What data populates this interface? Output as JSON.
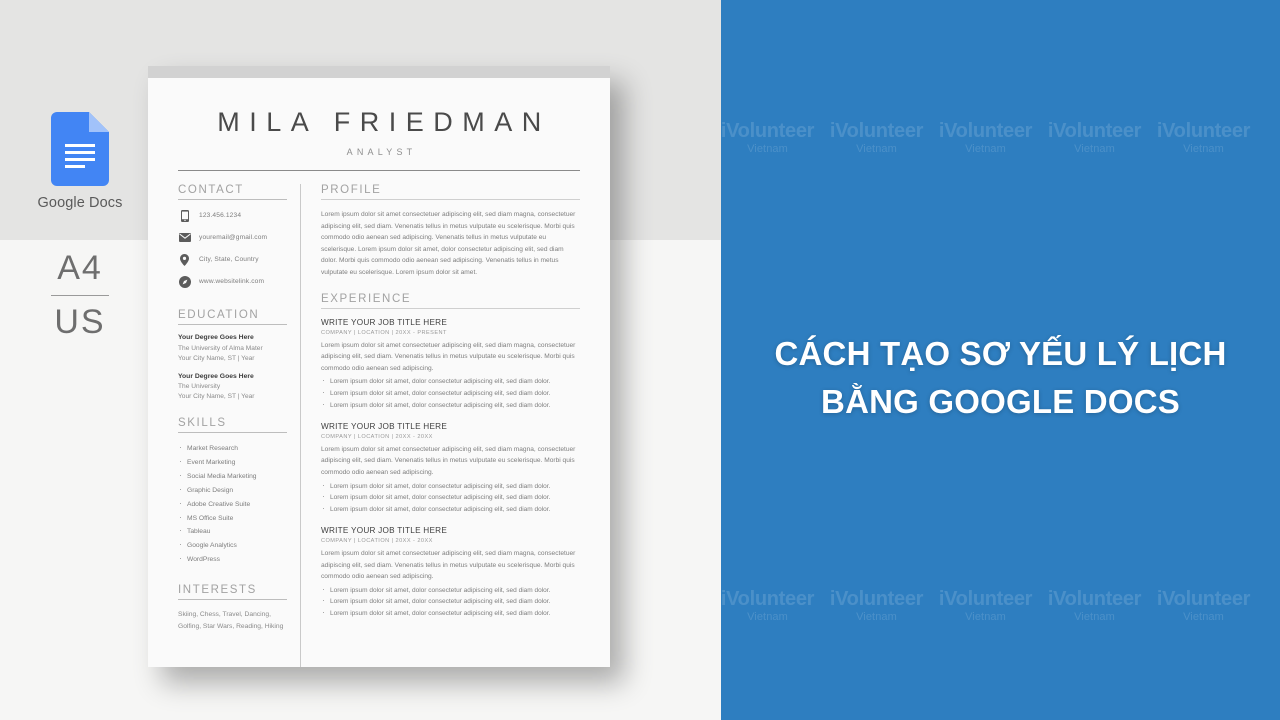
{
  "left_panel": {
    "app_badge": {
      "icon": "google-docs-icon",
      "label": "Google Docs"
    },
    "paper_size": {
      "top": "A4",
      "bottom": "US"
    }
  },
  "resume": {
    "name": "MILA FRIEDMAN",
    "role": "ANALYST",
    "contact": {
      "heading": "CONTACT",
      "items": [
        {
          "icon": "phone-icon",
          "text": "123.456.1234"
        },
        {
          "icon": "envelope-icon",
          "text": "youremail@gmail.com"
        },
        {
          "icon": "map-pin-icon",
          "text": "City, State, Country"
        },
        {
          "icon": "compass-icon",
          "text": "www.websitelink.com"
        }
      ]
    },
    "education": {
      "heading": "EDUCATION",
      "entries": [
        {
          "degree": "Your Degree Goes Here",
          "school": "The University of Alma Mater",
          "location": "Your City Name, ST  |  Year"
        },
        {
          "degree": "Your Degree Goes Here",
          "school": "The University",
          "location": "Your City Name, ST  |  Year"
        }
      ]
    },
    "skills": {
      "heading": "SKILLS",
      "items": [
        "Market Research",
        "Event Marketing",
        "Social Media Marketing",
        "Graphic Design",
        "Adobe Creative Suite",
        "MS Office Suite",
        "Tableau",
        "Google Analytics",
        "WordPress"
      ]
    },
    "interests": {
      "heading": "INTERESTS",
      "text": "Skiing, Chess, Travel, Dancing, Golfing, Star Wars, Reading, Hiking"
    },
    "profile": {
      "heading": "PROFILE",
      "body": "Lorem ipsum dolor sit amet consectetuer adipiscing elit, sed diam magna, consectetuer adipiscing elit, sed diam. Venenatis tellus in metus vulputate eu scelerisque. Morbi quis commodo odio aenean sed adipiscing. Venenatis tellus in metus vulputate eu scelerisque. Lorem ipsum dolor sit amet, dolor consectetur adipiscing elit, sed diam dolor. Morbi quis commodo odio aenean sed adipiscing. Venenatis tellus in metus vulputate eu scelerisque. Lorem ipsum dolor sit amet."
    },
    "experience": {
      "heading": "EXPERIENCE",
      "jobs": [
        {
          "title": "WRITE YOUR JOB TITLE HERE",
          "meta": "COMPANY  |  LOCATION  |  20XX - PRESENT",
          "body": "Lorem ipsum dolor sit amet consectetuer adipiscing elit, sed diam magna, consectetuer adipiscing elit, sed diam. Venenatis tellus in metus vulputate eu scelerisque. Morbi quis commodo odio aenean sed adipiscing.",
          "bullets": [
            "Lorem ipsum dolor sit amet, dolor consectetur adipiscing elit, sed diam dolor.",
            "Lorem ipsum dolor sit amet, dolor consectetur adipiscing elit, sed diam dolor.",
            "Lorem ipsum dolor sit amet, dolor consectetur adipiscing elit, sed diam dolor."
          ]
        },
        {
          "title": "WRITE YOUR JOB TITLE HERE",
          "meta": "COMPANY  |  LOCATION  |  20XX - 20XX",
          "body": "Lorem ipsum dolor sit amet consectetuer adipiscing elit, sed diam magna, consectetuer adipiscing elit, sed diam. Venenatis tellus in metus vulputate eu scelerisque. Morbi quis commodo odio aenean sed adipiscing.",
          "bullets": [
            "Lorem ipsum dolor sit amet, dolor consectetur adipiscing elit, sed diam dolor.",
            "Lorem ipsum dolor sit amet, dolor consectetur adipiscing elit, sed diam dolor.",
            "Lorem ipsum dolor sit amet, dolor consectetur adipiscing elit, sed diam dolor."
          ]
        },
        {
          "title": "WRITE YOUR JOB TITLE HERE",
          "meta": "COMPANY  |  LOCATION  |  20XX - 20XX",
          "body": "Lorem ipsum dolor sit amet consectetuer adipiscing elit, sed diam magna, consectetuer adipiscing elit, sed diam. Venenatis tellus in metus vulputate eu scelerisque. Morbi quis commodo odio aenean sed adipiscing.",
          "bullets": [
            "Lorem ipsum dolor sit amet, dolor consectetur adipiscing elit, sed diam dolor.",
            "Lorem ipsum dolor sit amet, dolor consectetur adipiscing elit, sed diam dolor.",
            "Lorem ipsum dolor sit amet, dolor consectetur adipiscing elit, sed diam dolor."
          ]
        }
      ]
    }
  },
  "right_panel": {
    "background_color": "#2e7ec0",
    "headline_line1": "CÁCH TẠO SƠ YẾU LÝ LỊCH",
    "headline_line2": "BẰNG GOOGLE DOCS",
    "watermark": {
      "main": "iVolunteer",
      "sub": "Vietnam",
      "repeat_per_row": 5,
      "rows": 2
    }
  }
}
